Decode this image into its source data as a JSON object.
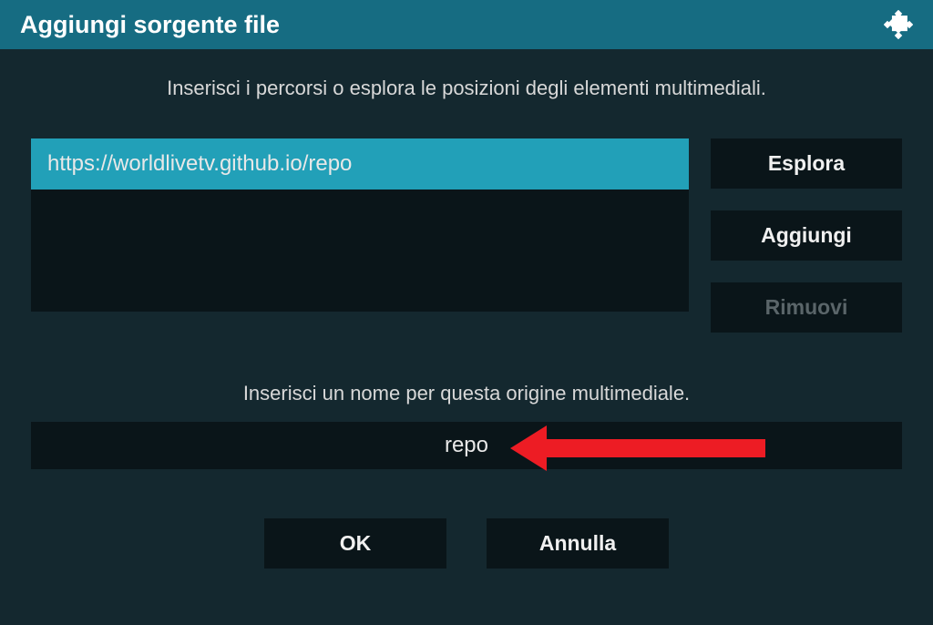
{
  "titlebar": {
    "title": "Aggiungi sorgente file"
  },
  "instructions": {
    "paths": "Inserisci i percorsi o esplora le posizioni degli elementi multimediali.",
    "name": "Inserisci un nome per questa origine multimediale."
  },
  "path": {
    "value": "https://worldlivetv.github.io/repo"
  },
  "buttons": {
    "browse": "Esplora",
    "add": "Aggiungi",
    "remove": "Rimuovi",
    "ok": "OK",
    "cancel": "Annulla"
  },
  "name_field": {
    "value": "repo"
  }
}
